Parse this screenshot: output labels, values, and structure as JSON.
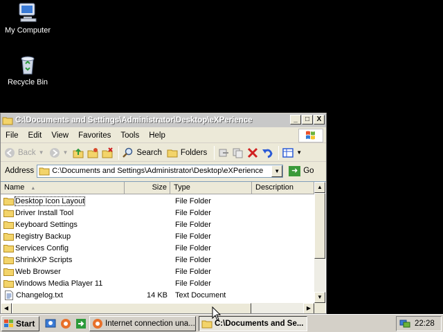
{
  "desktop": {
    "icons": [
      {
        "label": "My Computer",
        "icon": "my-computer-icon"
      },
      {
        "label": "Recycle Bin",
        "icon": "recycle-bin-icon"
      }
    ]
  },
  "window": {
    "title": "C:\\Documents and Settings\\Administrator\\Desktop\\eXPerience",
    "controls": {
      "minimize": "_",
      "maximize": "□",
      "close": "X"
    },
    "menu": [
      "File",
      "Edit",
      "View",
      "Favorites",
      "Tools",
      "Help"
    ],
    "toolbar": {
      "back": "Back",
      "search": "Search",
      "folders": "Folders"
    },
    "address": {
      "label": "Address",
      "value": "C:\\Documents and Settings\\Administrator\\Desktop\\eXPerience",
      "go": "Go"
    },
    "columns": {
      "name": "Name",
      "size": "Size",
      "type": "Type",
      "description": "Description"
    },
    "files": [
      {
        "name": "Desktop Icon Layout",
        "size": "",
        "type": "File Folder",
        "kind": "folder"
      },
      {
        "name": "Driver Install Tool",
        "size": "",
        "type": "File Folder",
        "kind": "folder"
      },
      {
        "name": "Keyboard Settings",
        "size": "",
        "type": "File Folder",
        "kind": "folder"
      },
      {
        "name": "Registry Backup",
        "size": "",
        "type": "File Folder",
        "kind": "folder"
      },
      {
        "name": "Services Config",
        "size": "",
        "type": "File Folder",
        "kind": "folder"
      },
      {
        "name": "ShrinkXP Scripts",
        "size": "",
        "type": "File Folder",
        "kind": "folder"
      },
      {
        "name": "Web Browser",
        "size": "",
        "type": "File Folder",
        "kind": "folder"
      },
      {
        "name": "Windows Media Player 11",
        "size": "",
        "type": "File Folder",
        "kind": "folder"
      },
      {
        "name": "Changelog.txt",
        "size": "14 KB",
        "type": "Text Document",
        "kind": "text"
      }
    ]
  },
  "taskbar": {
    "start": "Start",
    "tasks": [
      "Internet connection una...",
      "C:\\Documents and Se..."
    ],
    "clock": "22:28"
  }
}
